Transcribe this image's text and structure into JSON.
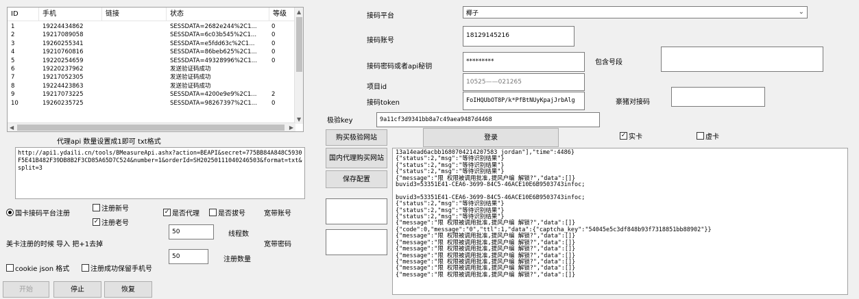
{
  "list": {
    "headers": {
      "id": "ID",
      "phone": "手机",
      "link": "链接",
      "status": "状态",
      "level": "等级"
    },
    "rows": [
      {
        "id": "1",
        "phone": "19224434862",
        "link": "",
        "status": "SESSDATA=2682e244%2C1...",
        "level": "0"
      },
      {
        "id": "2",
        "phone": "19217089058",
        "link": "",
        "status": "SESSDATA=6c03b545%2C1...",
        "level": "0"
      },
      {
        "id": "3",
        "phone": "19260255341",
        "link": "",
        "status": "SESSDATA=e5fdd63c%2C1...",
        "level": "0"
      },
      {
        "id": "4",
        "phone": "19210760816",
        "link": "",
        "status": "SESSDATA=86beb625%2C1...",
        "level": "0"
      },
      {
        "id": "5",
        "phone": "19220254659",
        "link": "",
        "status": "SESSDATA=49328996%2C1...",
        "level": "0"
      },
      {
        "id": "6",
        "phone": "19220237962",
        "link": "",
        "status": "发送验证码成功",
        "level": ""
      },
      {
        "id": "7",
        "phone": "19217052305",
        "link": "",
        "status": "发送验证码成功",
        "level": ""
      },
      {
        "id": "8",
        "phone": "19224423863",
        "link": "",
        "status": "发送验证码成功",
        "level": ""
      },
      {
        "id": "9",
        "phone": "19217073225",
        "link": "",
        "status": "SESSDATA=4200e9e9%2C1...",
        "level": "2"
      },
      {
        "id": "10",
        "phone": "19260235725",
        "link": "",
        "status": "SESSDATA=98267397%2C1...",
        "level": "0"
      }
    ]
  },
  "proxy": {
    "header": "代理api   数量设置成1即可   txt格式",
    "url": "http://api1.ydaili.cn/tools/BMeasureApi.ashx?action=BEAPI&secret=775BB84A848C5930F5E41B482F39DB8B2F3CD85A65D7C524&number=1&orderId=SH20250111040246503&format=txt&split=3"
  },
  "left_options": {
    "register_mode_label": "国卡接码平台注册",
    "register_new_label": "注册新号",
    "register_old_label": "注册老号",
    "use_proxy_label": "是否代理",
    "dial_label": "是否拔号",
    "broadband_account_label": "宽带账号",
    "threads_value": "50",
    "threads_label": "线程数",
    "broadband_password_label": "宽带密码",
    "import_hint": "美卡注册的时候 导入 把+1去掉",
    "register_count_value": "50",
    "register_count_label": "注册数量",
    "cookie_json_label": "cookie json 格式",
    "keep_phone_label": "注册成功保留手机号"
  },
  "bottom_buttons": {
    "start": "开始",
    "stop": "停止",
    "restore": "恢复"
  },
  "sms": {
    "platform_label": "接码平台",
    "platform_value": "椰子",
    "account_label": "接码账号",
    "account_value": "18129145216",
    "password_label": "接码密码或者api秘钥",
    "password_value": "*********",
    "segment_label": "包含号段",
    "project_label": "项目id",
    "project_value": "10525——021265",
    "token_label": "接码token",
    "token_value": "FoIHQUbOT8P/k*PfBtNUyKpajJrbAlg",
    "match_label": "豪猪对接码",
    "verify_key_label": "极验key",
    "verify_key_value": "9a11cf3d9341bb8a7c49aea9487d4468"
  },
  "actions": {
    "buy_verify": "购买极验网站",
    "domestic_proxy": "国内代理购买网站",
    "save_config": "保存配置",
    "login": "登录",
    "real_card_label": "实卡",
    "virtual_card_label": "虚卡"
  },
  "log_lines": [
    "13a14ead6acbb1680704214207583 jordan\"],\"time\":4486}",
    "{\"status\":2,\"msg\":\"等待识别结果\"}",
    "{\"status\":2,\"msg\":\"等待识别结果\"}",
    "{\"status\":2,\"msg\":\"等待识别结果\"}",
    "{\"message\":\"限  权限被调用批准,提风户编  解锁?\",\"data\":[]}",
    "buvid3=53351E41-CEA6-3699-84C5-46ACE10E6B9503743infoc;",
    "",
    "buvid3=53351E41-CEA6-3699-84C5-46ACE10E6B9503743infoc;",
    "{\"status\":2,\"msg\":\"等待识别结果\"}",
    "{\"status\":2,\"msg\":\"等待识别结果\"}",
    "{\"status\":2,\"msg\":\"等待识别结果\"}",
    "{\"message\":\"限  权限被调用批准,提风户编  解锁?\",\"data\":[]}",
    "{\"code\":0,\"message\":\"0\",\"ttl\":1,\"data\":{\"captcha_key\":\"54045e5c3df848b93f7318851bb88902\"}}",
    "{\"message\":\"限  权限被调用批准,提风户编  解锁?\",\"data\":[]}",
    "{\"message\":\"限  权限被调用批准,提风户编  解锁?\",\"data\":[]}",
    "{\"message\":\"限  权限被调用批准,提风户编  解锁?\",\"data\":[]}",
    "{\"message\":\"限  权限被调用批准,提风户编  解锁?\",\"data\":[]}",
    "{\"message\":\"限  权限被调用批准,提风户编  解锁?\",\"data\":[]}",
    "{\"message\":\"限  权限被调用批准,提风户编  解锁?\",\"data\":[]}",
    "{\"message\":\"限  权限被调用批准,提风户编  解锁?\",\"data\":[]}"
  ]
}
